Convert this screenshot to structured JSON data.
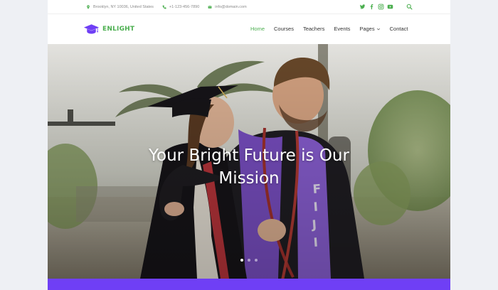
{
  "topbar": {
    "address": "Brooklyn, NY 10036, United States",
    "phone": "+1-123-456-7890",
    "email": "info@domain.com",
    "icons": [
      "map-pin-icon",
      "phone-icon",
      "envelope-icon"
    ],
    "social_icons": [
      "twitter-icon",
      "facebook-icon",
      "instagram-icon",
      "youtube-icon"
    ],
    "search_icon": "search-icon"
  },
  "brand": {
    "name": "ENLIGHT",
    "logo_icon": "graduation-cap-icon",
    "accent_color": "#4caf50",
    "logo_color": "#6f3ff5"
  },
  "nav": {
    "items": [
      {
        "label": "Home",
        "active": true
      },
      {
        "label": "Courses",
        "active": false
      },
      {
        "label": "Teachers",
        "active": false
      },
      {
        "label": "Events",
        "active": false
      },
      {
        "label": "Pages",
        "active": false,
        "dropdown": true
      },
      {
        "label": "Contact",
        "active": false
      }
    ]
  },
  "hero": {
    "title": "Your Bright Future is Our Mission",
    "sash_text": "FIJI",
    "slides": 3,
    "active_slide": 1
  },
  "footer_bar_color": "#6f3ff5"
}
